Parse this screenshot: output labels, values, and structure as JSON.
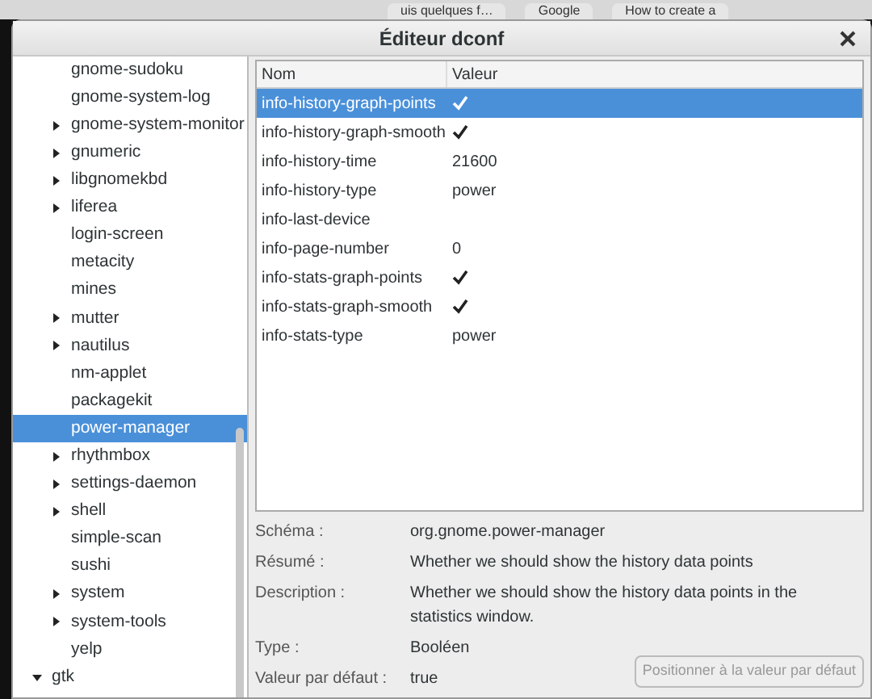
{
  "background_tabs": [
    {
      "label": "uis quelques f…"
    },
    {
      "label": "Google"
    },
    {
      "label": "How to create a"
    }
  ],
  "window": {
    "title": "Éditeur dconf"
  },
  "tree": [
    {
      "children": [
        {
          "label": "gnome-sudoku",
          "has_children": false,
          "selected": false
        },
        {
          "label": "gnome-system-log",
          "has_children": false,
          "selected": false
        },
        {
          "label": "gnome-system-monitor",
          "has_children": true,
          "selected": false
        },
        {
          "label": "gnumeric",
          "has_children": true,
          "selected": false
        },
        {
          "label": "libgnomekbd",
          "has_children": true,
          "selected": false
        },
        {
          "label": "liferea",
          "has_children": true,
          "selected": false
        },
        {
          "label": "login-screen",
          "has_children": false,
          "selected": false
        },
        {
          "label": "metacity",
          "has_children": false,
          "selected": false
        },
        {
          "label": "mines",
          "has_children": false,
          "selected": false
        },
        {
          "label": "mutter",
          "has_children": true,
          "selected": false
        },
        {
          "label": "nautilus",
          "has_children": true,
          "selected": false
        },
        {
          "label": "nm-applet",
          "has_children": false,
          "selected": false
        },
        {
          "label": "packagekit",
          "has_children": false,
          "selected": false
        },
        {
          "label": "power-manager",
          "has_children": false,
          "selected": true
        },
        {
          "label": "rhythmbox",
          "has_children": true,
          "selected": false
        },
        {
          "label": "settings-daemon",
          "has_children": true,
          "selected": false
        },
        {
          "label": "shell",
          "has_children": true,
          "selected": false
        },
        {
          "label": "simple-scan",
          "has_children": false,
          "selected": false
        },
        {
          "label": "sushi",
          "has_children": false,
          "selected": false
        },
        {
          "label": "system",
          "has_children": true,
          "selected": false
        },
        {
          "label": "system-tools",
          "has_children": true,
          "selected": false
        },
        {
          "label": "yelp",
          "has_children": false,
          "selected": false
        }
      ]
    },
    {
      "label": "gtk",
      "has_children": true,
      "expanded": true,
      "selected": false
    }
  ],
  "table": {
    "columns": [
      "Nom",
      "Valeur"
    ],
    "rows": [
      {
        "name": "info-history-graph-points",
        "kind": "check",
        "checked": true,
        "selected": true
      },
      {
        "name": "info-history-graph-smooth",
        "kind": "check",
        "checked": true,
        "selected": false
      },
      {
        "name": "info-history-time",
        "kind": "text",
        "value": "21600",
        "selected": false
      },
      {
        "name": "info-history-type",
        "kind": "text",
        "value": "power",
        "selected": false
      },
      {
        "name": "info-last-device",
        "kind": "text",
        "selected": false
      },
      {
        "name": "info-page-number",
        "kind": "text",
        "value": "0",
        "selected": false
      },
      {
        "name": "info-stats-graph-points",
        "kind": "check",
        "checked": true,
        "selected": false
      },
      {
        "name": "info-stats-graph-smooth",
        "kind": "check",
        "checked": true,
        "selected": false
      },
      {
        "name": "info-stats-type",
        "kind": "text",
        "value": "power",
        "selected": false
      }
    ]
  },
  "details": [
    {
      "label": "Schéma :",
      "value": "org.gnome.power-manager"
    },
    {
      "label": "Résumé :",
      "value": "Whether we should show the history data points"
    },
    {
      "label": "Description :",
      "value": "Whether we should show the history data points in the statistics window."
    },
    {
      "label": "Type :",
      "value": "Booléen"
    },
    {
      "label": "Valeur par défaut :",
      "value": "true"
    }
  ],
  "reset_button": {
    "label": "Positionner à la valeur par défaut",
    "disabled": true
  }
}
